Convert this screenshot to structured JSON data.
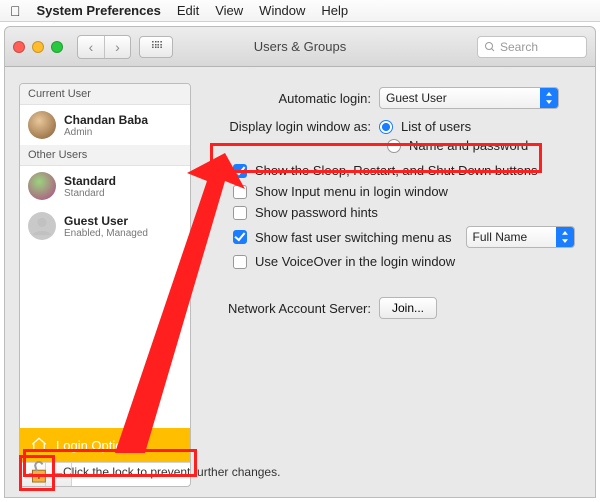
{
  "menubar": {
    "appname": "System Preferences",
    "items": [
      "Edit",
      "View",
      "Window",
      "Help"
    ]
  },
  "window": {
    "title": "Users & Groups",
    "search_placeholder": "Search"
  },
  "sidebar": {
    "section_current": "Current User",
    "section_other": "Other Users",
    "current": {
      "name": "Chandan Baba",
      "role": "Admin"
    },
    "others": [
      {
        "name": "Standard",
        "role": "Standard"
      },
      {
        "name": "Guest User",
        "role": "Enabled, Managed"
      }
    ],
    "login_options": "Login Options"
  },
  "main": {
    "auto_login_label": "Automatic login:",
    "auto_login_value": "Guest User",
    "display_login_label": "Display login window as:",
    "radio_list": "List of users",
    "radio_namepw": "Name and password",
    "chk_sleep": "Show the Sleep, Restart, and Shut Down buttons",
    "chk_inputmenu": "Show Input menu in login window",
    "chk_pwhints": "Show password hints",
    "chk_fastswitch": "Show fast user switching menu as",
    "fastswitch_value": "Full Name",
    "chk_voiceover": "Use VoiceOver in the login window",
    "net_label": "Network Account Server:",
    "join_btn": "Join...",
    "checks": {
      "sleep": true,
      "inputmenu": false,
      "pwhints": false,
      "fastswitch": true,
      "voiceover": false
    },
    "radio_selected": "list"
  },
  "footer": {
    "lock_text": "Click the lock to prevent further changes."
  }
}
